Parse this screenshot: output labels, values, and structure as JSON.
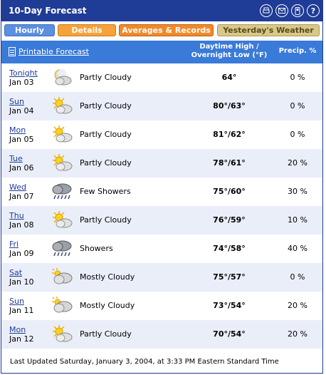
{
  "titlebar": {
    "title": "10-Day Forecast",
    "icons": [
      "print-icon",
      "email-icon",
      "phone-icon",
      "help-icon"
    ]
  },
  "tabs": {
    "hourly": "Hourly",
    "details": "Details",
    "averages": "Averages & Records",
    "yesterday": "Yesterday's Weather"
  },
  "header": {
    "printable": "Printable Forecast",
    "temp_line1": "Daytime High /",
    "temp_line2": "Overnight Low (°F)",
    "precip": "Precip. %"
  },
  "rows": [
    {
      "day": "Tonight",
      "date": "Jan 03",
      "icon": "moon-cloud-icon",
      "cond": "Partly Cloudy",
      "temp": "64°",
      "precip": "0 %"
    },
    {
      "day": "Sun",
      "date": "Jan 04",
      "icon": "sun-cloud-icon",
      "cond": "Partly Cloudy",
      "temp": "80°/63°",
      "precip": "0 %"
    },
    {
      "day": "Mon",
      "date": "Jan 05",
      "icon": "sun-cloud-icon",
      "cond": "Partly Cloudy",
      "temp": "81°/62°",
      "precip": "0 %"
    },
    {
      "day": "Tue",
      "date": "Jan 06",
      "icon": "sun-cloud-icon",
      "cond": "Partly Cloudy",
      "temp": "78°/61°",
      "precip": "20 %"
    },
    {
      "day": "Wed",
      "date": "Jan 07",
      "icon": "rain-cloud-icon",
      "cond": "Few Showers",
      "temp": "75°/60°",
      "precip": "30 %"
    },
    {
      "day": "Thu",
      "date": "Jan 08",
      "icon": "sun-cloud-icon",
      "cond": "Partly Cloudy",
      "temp": "76°/59°",
      "precip": "10 %"
    },
    {
      "day": "Fri",
      "date": "Jan 09",
      "icon": "rain-cloud-icon",
      "cond": "Showers",
      "temp": "74°/58°",
      "precip": "40 %"
    },
    {
      "day": "Sat",
      "date": "Jan 10",
      "icon": "mostly-cloudy-icon",
      "cond": "Mostly Cloudy",
      "temp": "75°/57°",
      "precip": "0 %"
    },
    {
      "day": "Sun",
      "date": "Jan 11",
      "icon": "mostly-cloudy-icon",
      "cond": "Mostly Cloudy",
      "temp": "73°/54°",
      "precip": "20 %"
    },
    {
      "day": "Mon",
      "date": "Jan 12",
      "icon": "sun-cloud-icon",
      "cond": "Partly Cloudy",
      "temp": "70°/54°",
      "precip": "20 %"
    }
  ],
  "footer": {
    "updated": "Last Updated Saturday, January 3, 2004, at 3:33 PM Eastern Standard Time"
  }
}
